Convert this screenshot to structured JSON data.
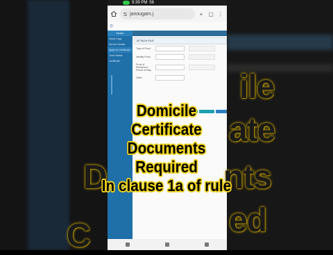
{
  "status": {
    "time": "9:39 PM",
    "extra": "56"
  },
  "browser": {
    "url": "janougam.j"
  },
  "site": {
    "sidebar_title": "Home",
    "sidebar_items": [
      "Home Page",
      "Service Details",
      "Apply for Certificate",
      "Track Status",
      "Certificate"
    ],
    "card_header": "ATTACH FILE",
    "row_labels": [
      "Type of Proof",
      "Identity Proof",
      "Proof of Residence / Period of Stay",
      "Other"
    ]
  },
  "caption": {
    "line1": "Domicile",
    "line2": "Certificate",
    "line3": "Documents",
    "line4": "Required",
    "line5": "In clause 1a of rule"
  },
  "background_text": {
    "right_1": "ile",
    "right_2": "ate",
    "right_3": "nts",
    "right_4": "ed",
    "left_1": "D",
    "left_2": "C"
  },
  "colors": {
    "caption_outline": "#f0d21c",
    "sidebar": "#1f6fa8",
    "mic": "#2ec94a"
  }
}
